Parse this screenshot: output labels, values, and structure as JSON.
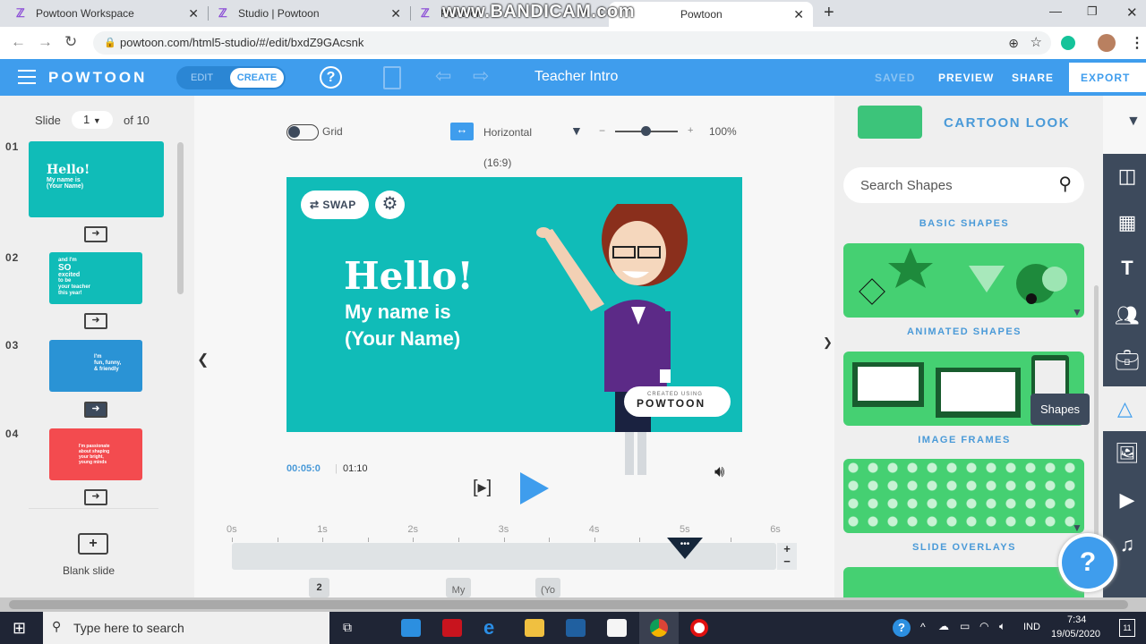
{
  "browser": {
    "tabs": [
      {
        "title": "Powtoon Workspace"
      },
      {
        "title": "Studio | Powtoon"
      },
      {
        "title": "Powtoon"
      },
      {
        "title": "Powtoon"
      }
    ],
    "watermark": "www.BANDICAM.com",
    "url": "powtoon.com/html5-studio/#/edit/bxdZ9GAcsnk"
  },
  "header": {
    "logo": "POWTOON",
    "mode_edit": "EDIT",
    "mode_create": "CREATE",
    "help": "?",
    "title": "Teacher Intro",
    "saved": "SAVED",
    "preview": "PREVIEW",
    "share": "SHARE",
    "export": "EXPORT"
  },
  "slides_panel": {
    "slide_label": "Slide",
    "current": "1",
    "of": "of 10",
    "blank": "Blank slide",
    "slides": [
      {
        "num": "01",
        "lines": [
          "Hello!",
          "My name is",
          "(Your Name)"
        ],
        "color": "#10bcb8"
      },
      {
        "num": "02",
        "lines": [
          "and I'm",
          "SO",
          "excited",
          "to be",
          "your teacher",
          "this year!"
        ],
        "color": "#10bcb8"
      },
      {
        "num": "03",
        "lines": [
          "I'm",
          "fun, funny,",
          "& friendly"
        ],
        "color": "#2a93d5"
      },
      {
        "num": "04",
        "lines": [
          "I'm passionate",
          "about shaping",
          "your bright,",
          "young minds"
        ],
        "color": "#f34b4f"
      }
    ]
  },
  "canvas": {
    "grid": "Grid",
    "orientation": "Horizontal",
    "ratio": "(16:9)",
    "zoom": "100%",
    "zoom_level": 0.5,
    "swap": "SWAP",
    "hello": "Hello!",
    "name1": "My name is",
    "name2": "(Your Name)",
    "badge_small": "CREATED USING",
    "badge": "POWTOON"
  },
  "player": {
    "current": "00:05:0",
    "total": "01:10"
  },
  "timeline": {
    "ticks": [
      "0s",
      "1s",
      "2s",
      "3s",
      "4s",
      "5s",
      "6s"
    ],
    "playhead_seconds": 5,
    "markers": [
      "2",
      "My",
      "(Yo"
    ]
  },
  "right_panel": {
    "look": "CARTOON LOOK",
    "search_placeholder": "Search Shapes",
    "categories": [
      "BASIC SHAPES",
      "ANIMATED SHAPES",
      "IMAGE FRAMES",
      "SLIDE OVERLAYS"
    ],
    "tooltip": "Shapes",
    "help": "?"
  },
  "taskbar": {
    "search": "Type here to search",
    "lang": "IND",
    "time": "7:34",
    "date": "19/05/2020",
    "notif": "11"
  },
  "colors": {
    "accent": "#3f9ded",
    "slide": "#10bcb8",
    "green": "#45d072",
    "dark": "#3d4a5c"
  }
}
